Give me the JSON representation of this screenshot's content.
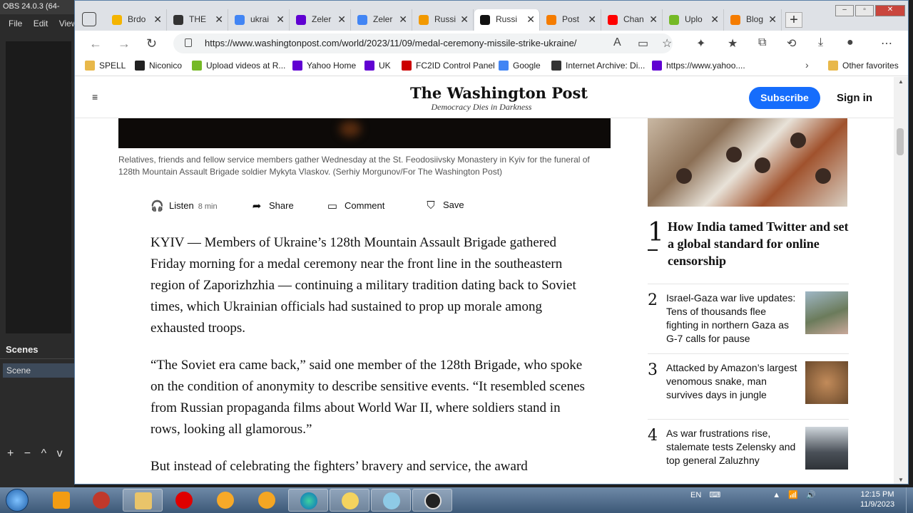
{
  "obs": {
    "title": "OBS 24.0.3 (64-",
    "menu": [
      "File",
      "Edit",
      "View"
    ],
    "scenes_header": "Scenes",
    "scene_item": "Scene",
    "tools": [
      "+",
      "−",
      "^",
      "v"
    ]
  },
  "browser": {
    "tabs": [
      {
        "label": "Brdo",
        "icon_color": "#f4b400"
      },
      {
        "label": "THE",
        "icon_color": "#333333"
      },
      {
        "label": "ukrai",
        "icon_color": "#4285f4"
      },
      {
        "label": "Zeler",
        "icon_color": "#6001d2"
      },
      {
        "label": "Zeler",
        "icon_color": "#4285f4"
      },
      {
        "label": "Russi",
        "icon_color": "#f29900"
      },
      {
        "label": "Russi",
        "icon_color": "#111111"
      },
      {
        "label": "Post",
        "icon_color": "#f57c00"
      },
      {
        "label": "Chan",
        "icon_color": "#ff0000"
      },
      {
        "label": "Uplo",
        "icon_color": "#75b926"
      },
      {
        "label": "Blog",
        "icon_color": "#f57c00"
      }
    ],
    "url": "https://www.washingtonpost.com/world/2023/11/09/medal-ceremony-missile-strike-ukraine/",
    "bookmarks": [
      {
        "label": "SPELL",
        "icon_color": "#e8b84a"
      },
      {
        "label": "Niconico",
        "icon_color": "#222222"
      },
      {
        "label": "Upload videos at R...",
        "icon_color": "#75b926"
      },
      {
        "label": "Yahoo Home",
        "icon_color": "#6001d2"
      },
      {
        "label": "UK",
        "icon_color": "#6001d2"
      },
      {
        "label": "FC2ID Control Panel",
        "icon_color": "#cc0000"
      },
      {
        "label": "Google",
        "icon_color": "#4285f4"
      },
      {
        "label": "Internet Archive: Di...",
        "icon_color": "#333333"
      },
      {
        "label": "https://www.yahoo....",
        "icon_color": "#6001d2"
      }
    ],
    "other_favorites": "Other favorites"
  },
  "page": {
    "logo": "The Washington Post",
    "tagline": "Democracy Dies in Darkness",
    "subscribe": "Subscribe",
    "signin": "Sign in",
    "caption": "Relatives, friends and fellow service members gather Wednesday at the St. Feodosiivsky Monastery in Kyiv for the funeral of 128th Mountain Assault Brigade soldier Mykyta Vlaskov. (Serhiy Morgunov/For The Washington Post)",
    "actions": {
      "listen": "Listen",
      "listen_duration": "8 min",
      "share": "Share",
      "comment": "Comment",
      "save": "Save"
    },
    "paragraphs": [
      "KYIV — Members of Ukraine’s 128th Mountain Assault Brigade gathered Friday morning for a medal ceremony near the front line in the southeastern region of Zaporizhzhia — continuing a military tradition dating back to Soviet times, which Ukrainian officials had sustained to prop up morale among exhausted troops.",
      "“The Soviet era came back,” said one member of the 128th Brigade, who spoke on the condition of anonymity to describe sensitive events. “It resembled scenes from Russian propaganda films about World War II, where soldiers stand in rows, looking all glamorous.”",
      "But instead of celebrating the fighters’ bravery and service, the award"
    ]
  },
  "sidebar": {
    "items": [
      {
        "num": "1",
        "headline": "How India tamed Twitter and set a global standard for online censorship"
      },
      {
        "num": "2",
        "headline": "Israel-Gaza war live updates: Tens of thousands flee fighting in northern Gaza as G-7 calls for pause"
      },
      {
        "num": "3",
        "headline": "Attacked by Amazon’s largest venomous snake, man survives days in jungle"
      },
      {
        "num": "4",
        "headline": "As war frustrations rise, stalemate tests Zelensky and top general Zaluzhny"
      }
    ]
  },
  "taskbar": {
    "lang": "EN",
    "time": "12:15 PM",
    "date": "11/9/2023"
  }
}
